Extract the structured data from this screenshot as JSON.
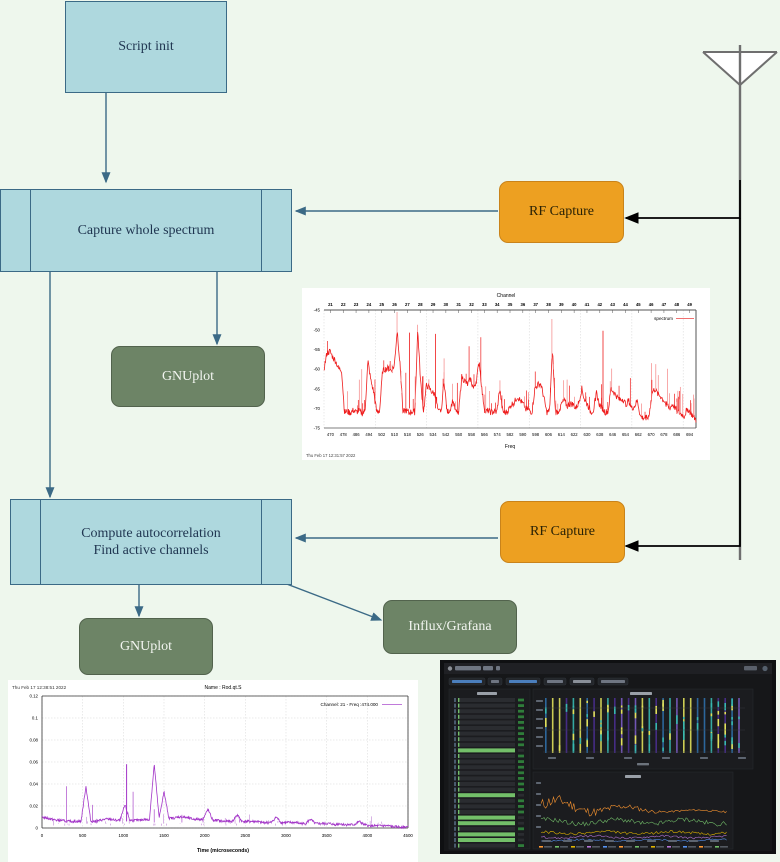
{
  "diagram": {
    "background_color": "#eef7ed",
    "nodes": [
      {
        "id": "script-init",
        "label": "Script init",
        "shape": "rect",
        "color": "#aed8de"
      },
      {
        "id": "capture-whole-spectrum",
        "label": "Capture whole spectrum",
        "shape": "subroutine",
        "color": "#aed8de"
      },
      {
        "id": "gnuplot-top",
        "label": "GNUplot",
        "shape": "rounded",
        "color": "#6d8466"
      },
      {
        "id": "compute-autocorrelation",
        "label": "Compute autocorrelation\nFind active channels",
        "line1": "Compute autocorrelation",
        "line2": "Find active channels",
        "shape": "subroutine",
        "color": "#aed8de"
      },
      {
        "id": "gnuplot-bottom",
        "label": "GNUplot",
        "shape": "rounded",
        "color": "#6d8466"
      },
      {
        "id": "influx-grafana",
        "label": "Influx/Grafana",
        "shape": "rounded",
        "color": "#6d8466"
      },
      {
        "id": "rf-capture-top",
        "label": "RF Capture",
        "shape": "rounded",
        "color": "#eda021"
      },
      {
        "id": "rf-capture-bottom",
        "label": "RF Capture",
        "shape": "rounded",
        "color": "#eda021"
      }
    ],
    "antenna": {
      "name": "antenna-symbol",
      "color": "#6f6f6f"
    },
    "edge_color": "#3b6a86",
    "signal_edge_color": "#000000"
  },
  "chart_data": [
    {
      "id": "spectrum-plot",
      "type": "line",
      "title": "Channel",
      "xlabel": "Freq",
      "ylabel": "",
      "legend": [
        "spectrum"
      ],
      "legend_position": "top-right",
      "timestamp": "Thu Feb 17 12:31:57 2022",
      "series_color": "#ee1b1b",
      "top_axis_label": "Channel",
      "top_ticks": [
        21,
        22,
        23,
        24,
        25,
        26,
        27,
        28,
        29,
        30,
        31,
        32,
        33,
        34,
        35,
        36,
        37,
        38,
        39,
        40,
        41,
        42,
        43,
        44,
        45,
        46,
        47,
        48,
        49
      ],
      "xticks": [
        470,
        478,
        486,
        494,
        502,
        510,
        518,
        526,
        534,
        542,
        550,
        558,
        566,
        574,
        582,
        590,
        598,
        606,
        614,
        622,
        630,
        638,
        646,
        654,
        662,
        670,
        678,
        686,
        694
      ],
      "xlim": [
        470,
        698
      ],
      "yticks": [
        -45,
        -50,
        -55,
        -60,
        -65,
        -70,
        -75
      ],
      "ylim": [
        -75,
        -45
      ],
      "grid": true,
      "values": [
        -60,
        -56,
        -55.5,
        -57,
        -58,
        -60,
        -60.2,
        -71,
        -70.8,
        -71.2,
        -70.5,
        -71,
        -70.6,
        -71.3,
        -70.7,
        -58,
        -63,
        -66,
        -71,
        -70.6,
        -60.5,
        -60,
        -59.8,
        -60.4,
        -59.2,
        -50,
        -59.5,
        -71,
        -70.5,
        -71.2,
        -70.8,
        -71,
        -50,
        -63.5,
        -70.9,
        -64,
        -65,
        -66,
        -66.5,
        -71,
        -70.5,
        -63,
        -71,
        -70.4,
        -68,
        -71,
        -70.8,
        -62,
        -63,
        -64,
        -62.5,
        -65,
        -63,
        -58,
        -66,
        -71,
        -70.6,
        -71,
        -70.9,
        -71,
        -65,
        -70.8,
        -71.2,
        -70.4,
        -69,
        -68.5,
        -67,
        -68,
        -69,
        -70,
        -70.5,
        -71,
        -65,
        -64,
        -63.8,
        -67,
        -71,
        -70.7,
        -55,
        -71,
        -70.8,
        -69,
        -68,
        -69.5,
        -68.8,
        -69,
        -70,
        -68.5,
        -65,
        -68,
        -69,
        -71,
        -70.5,
        -66,
        -69,
        -70,
        -71,
        -70.8,
        -65,
        -66,
        -67,
        -68,
        -67.5,
        -69,
        -68,
        -70,
        -69.5,
        -68,
        -72,
        -72.5,
        -72.2,
        -71.8,
        -66,
        -65,
        -66.5,
        -67,
        -68,
        -69,
        -70,
        -69,
        -70,
        -71,
        -71.5,
        -72,
        -70,
        -71,
        -72,
        -73
      ]
    },
    {
      "id": "autocorrelation-plot",
      "type": "line",
      "title": "Name : Rod.qt.S",
      "xlabel": "Time (microseconds)",
      "ylabel": "",
      "legend": [
        "Channel: 21 - Freq :474.000"
      ],
      "legend_position": "top-right",
      "timestamp": "Thu Feb 17 12:38:51 2022",
      "series_color": "#a335c8",
      "xticks": [
        0,
        500,
        1000,
        1500,
        2000,
        2500,
        3000,
        3500,
        4000,
        4500
      ],
      "xlim": [
        0,
        4500
      ],
      "yticks": [
        0,
        0.02,
        0.04,
        0.06,
        0.08,
        0.1,
        0.12
      ],
      "ytick_labels": [
        "0",
        "0.02",
        "0.04",
        "0.06",
        "0.08",
        "0.1",
        "0.12"
      ],
      "ylim": [
        0,
        0.12
      ],
      "grid": true,
      "peak_x": 1040,
      "peak_y": 0.058,
      "values": [
        0.01,
        0.009,
        0.008,
        0.007,
        0.007,
        0.006,
        0.006,
        0.006,
        0.006,
        0.038,
        0.006,
        0.006,
        0.007,
        0.008,
        0.008,
        0.007,
        0.007,
        0.021,
        0.007,
        0.007,
        0.007,
        0.008,
        0.007,
        0.058,
        0.009,
        0.033,
        0.009,
        0.009,
        0.01,
        0.01,
        0.009,
        0.008,
        0.008,
        0.008,
        0.017,
        0.007,
        0.007,
        0.006,
        0.006,
        0.006,
        0.012,
        0.006,
        0.006,
        0.006,
        0.006,
        0.005,
        0.005,
        0.005,
        0.01,
        0.005,
        0.005,
        0.005,
        0.005,
        0.004,
        0.004,
        0.008,
        0.004,
        0.004,
        0.004,
        0.004,
        0.003,
        0.004,
        0.003,
        0.003,
        0.003,
        0.006,
        0.003,
        0.002,
        0.002,
        0.002,
        0.002,
        0.002,
        0.001,
        0.001,
        0.001,
        0.001
      ]
    }
  ],
  "grafana": {
    "id": "grafana-dashboard-screenshot",
    "toolbar_items": [
      "menu",
      "dashboard-title",
      "share",
      "time-range",
      "refresh"
    ],
    "panels": [
      {
        "name": "levels-bar-list",
        "type": "bar"
      },
      {
        "name": "heatmap-panel",
        "type": "heatmap"
      },
      {
        "name": "lines-panel",
        "type": "line"
      }
    ],
    "accent_green": "#73bf69",
    "accent_yellow": "#e0e05a",
    "accent_teal": "#37b8b0",
    "accent_purple": "#7b5cc4",
    "accent_orange": "#ff9830",
    "background": "#161719"
  }
}
